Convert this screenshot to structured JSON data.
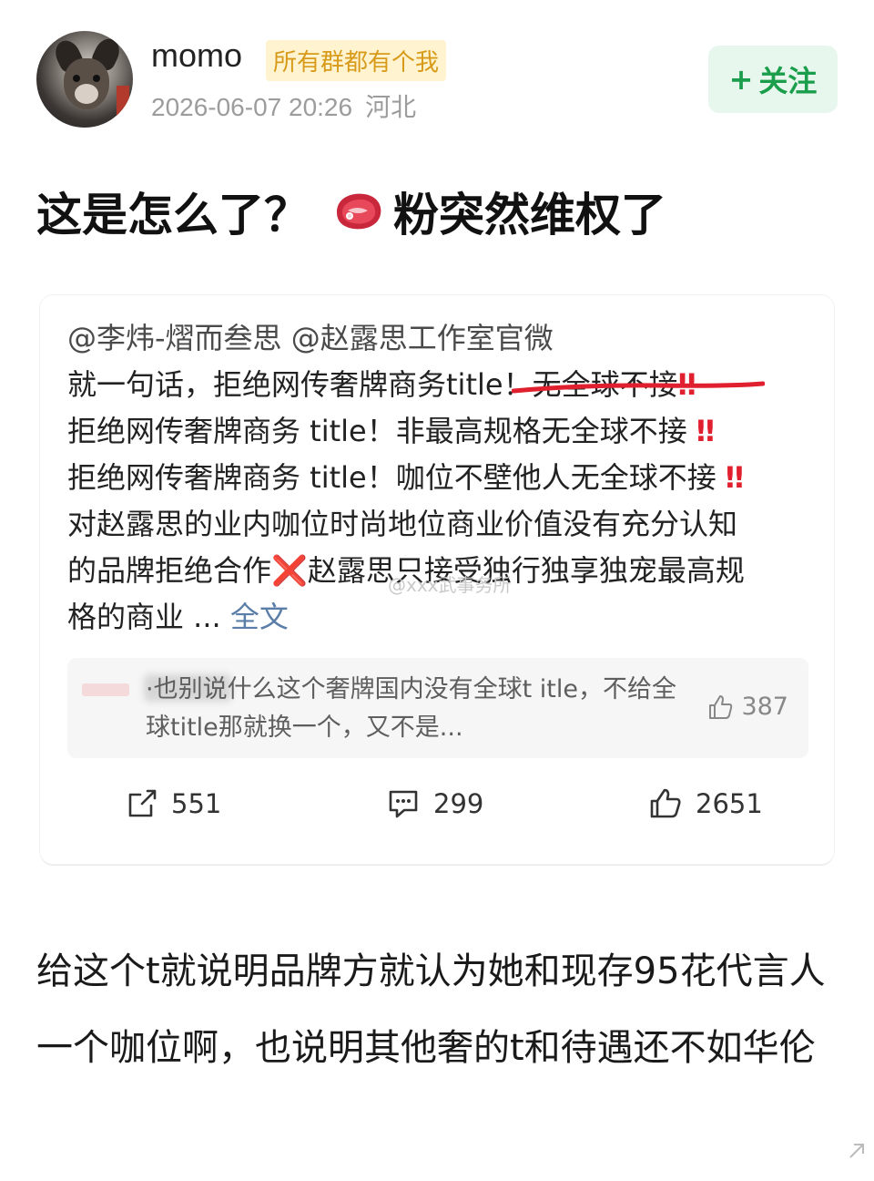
{
  "post": {
    "username": "momo",
    "badge": "所有群都有个我",
    "date": "2026-06-07 20:26",
    "location": "河北",
    "follow_label": "关注",
    "follow_plus": "+",
    "title_before": "这是怎么了？",
    "title_after": "粉突然维权了",
    "title_icon": "meat-icon"
  },
  "card": {
    "mentions": "@李炜-熠而叁思 @赵露思工作室官微",
    "lines": [
      "就一句话，拒绝网传奢牌商务title！无全球不接",
      "拒绝网传奢牌商务 title！非最高规格无全球不接",
      "拒绝网传奢牌商务 title！咖位不壁他人无全球不接",
      "对赵露思的业内咖位时尚地位商业价值没有充分认知",
      "的品牌拒绝合作",
      "赵露思只接受独行独享独宠最高规",
      "格的商业 ..."
    ],
    "excl": "‼",
    "cross": "❌",
    "full_text_link": "全文",
    "watermark": "@xxx武事务所",
    "comment": {
      "text": "·也别说什么这个奢牌国内没有全球t itle，不给全球title那就换一个，又不是...",
      "likes": "387"
    },
    "actions": {
      "share": "551",
      "comments": "299",
      "likes": "2651"
    }
  },
  "body": {
    "text": "给这个t就说明品牌方就认为她和现存95花代言人一个咖位啊，也说明其他奢的t和待遇还不如华伦"
  },
  "colors": {
    "follow_green": "#1a9e4b",
    "badge_gold": "#d89a1a",
    "excl_red": "#e0202e",
    "link_blue": "#5b7ea8"
  }
}
